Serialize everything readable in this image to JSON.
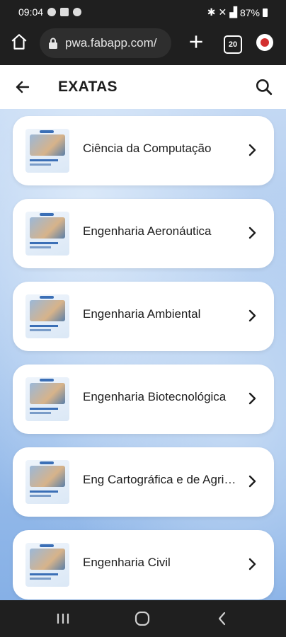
{
  "status_bar": {
    "time": "09:04",
    "battery": "87%"
  },
  "browser": {
    "url": "pwa.fabapp.com/",
    "tab_count": "20"
  },
  "app_bar": {
    "title": "EXATAS"
  },
  "courses": [
    {
      "label": "Ciência da Computação"
    },
    {
      "label": "Engenharia Aeronáutica"
    },
    {
      "label": "Engenharia Ambiental"
    },
    {
      "label": "Engenharia Biotecnológica"
    },
    {
      "label": "Eng Cartográfica e de Agrimensura"
    },
    {
      "label": "Engenharia Civil"
    }
  ],
  "colors": {
    "card_bg": "#ffffff",
    "background_blue": "#9fc1ec",
    "chrome_dark": "#1f1f1f"
  }
}
